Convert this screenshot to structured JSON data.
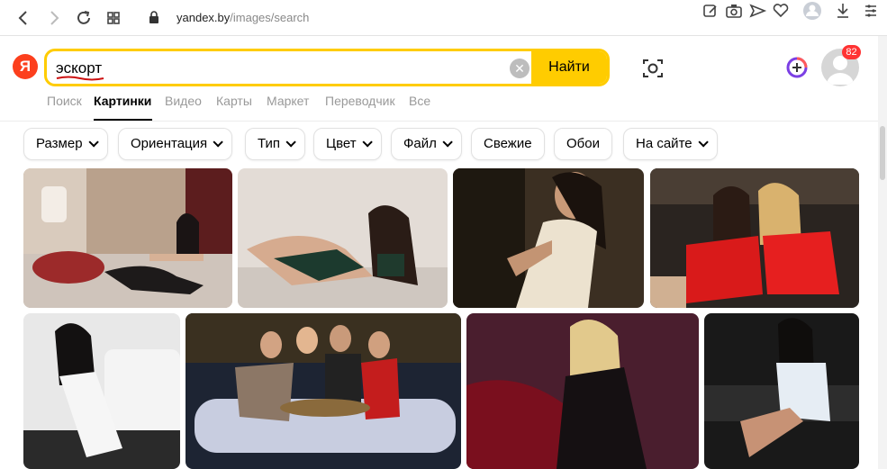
{
  "browser": {
    "url_host": "yandex.by",
    "url_path": "/images/search"
  },
  "header": {
    "logo": "Я",
    "query": "эскорт",
    "search_button": "Найти",
    "badge_count": "82"
  },
  "services": [
    {
      "label": "Поиск"
    },
    {
      "label": "Картинки"
    },
    {
      "label": "Видео"
    },
    {
      "label": "Карты"
    },
    {
      "label": "Маркет"
    },
    {
      "label": "Переводчик"
    },
    {
      "label": "Все"
    }
  ],
  "filters": [
    {
      "label": "Размер"
    },
    {
      "label": "Ориентация"
    },
    {
      "label": "Тип"
    },
    {
      "label": "Цвет"
    },
    {
      "label": "Файл"
    },
    {
      "label": "Свежие"
    },
    {
      "label": "Обои"
    },
    {
      "label": "На сайте"
    }
  ],
  "colors": {
    "accent": "#ffcc00",
    "logo": "#fc3f1d",
    "badge": "#ff3333"
  }
}
